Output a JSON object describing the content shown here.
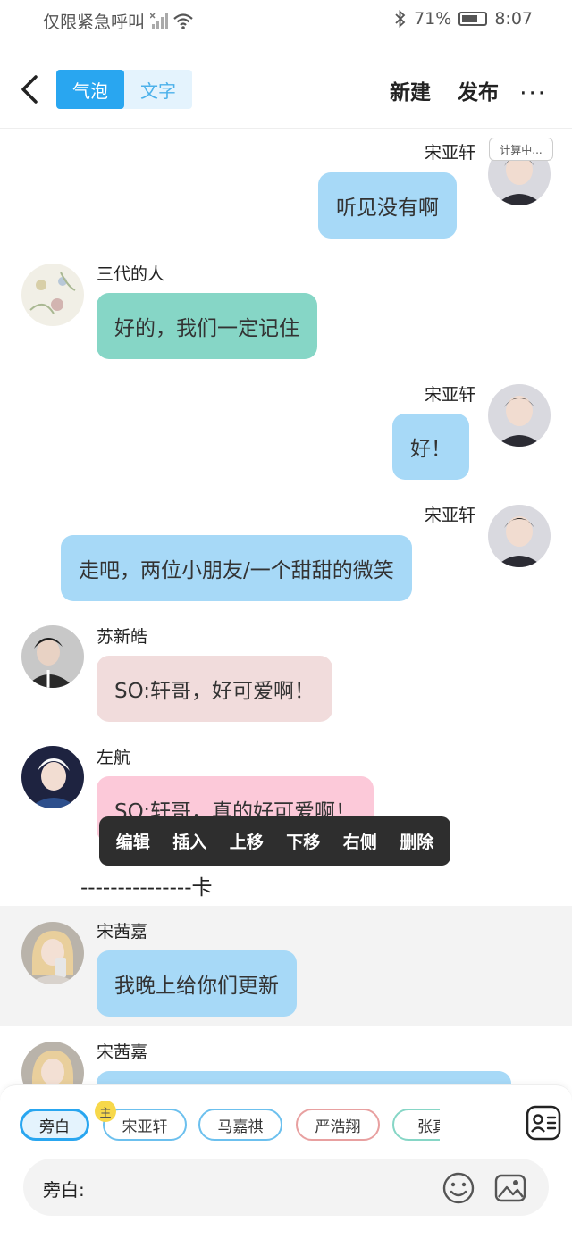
{
  "status_bar": {
    "carrier": "仅限紧急呼叫",
    "battery": "71%",
    "battery_level": 0.71,
    "time": "8:07"
  },
  "header": {
    "tabs": [
      {
        "label": "气泡",
        "active": true
      },
      {
        "label": "文字",
        "active": false
      }
    ],
    "new_label": "新建",
    "publish_label": "发布",
    "more_label": "···"
  },
  "calc_tag": "计算中...",
  "messages": [
    {
      "sender": "宋亚轩",
      "text": "听见没有啊",
      "side": "right"
    },
    {
      "sender": "三代的人",
      "text": "好的，我们一定记住",
      "side": "left"
    },
    {
      "sender": "宋亚轩",
      "text": "好！",
      "side": "right"
    },
    {
      "sender": "宋亚轩",
      "text": "走吧，两位小朋友/一个甜甜的微笑",
      "side": "right"
    },
    {
      "sender": "苏新皓",
      "text": "SO:轩哥，好可爱啊！",
      "side": "left"
    },
    {
      "sender": "左航",
      "text": "SO:轩哥，真的好可爱啊！",
      "side": "left"
    },
    {
      "sender": "宋茜嘉",
      "text": "我晚上给你们更新",
      "side": "left"
    },
    {
      "sender": "宋茜嘉",
      "text": "",
      "side": "left"
    }
  ],
  "context_menu": [
    "编辑",
    "插入",
    "上移",
    "下移",
    "右侧",
    "删除"
  ],
  "scene_divider": "---------------卡",
  "roles": [
    {
      "label": "旁白"
    },
    {
      "label": "宋亚轩"
    },
    {
      "label": "马嘉祺"
    },
    {
      "label": "严浩翔"
    },
    {
      "label": "张真"
    }
  ],
  "host_badge": "主",
  "input": {
    "label": "旁白:",
    "value": ""
  },
  "colors": {
    "accent": "#29a6f0",
    "bubble_blue": "#a7d9f7",
    "bubble_teal": "#86d6c6",
    "bubble_rose": "#f1dcdc",
    "bubble_pink": "#fcc9d9",
    "menu_bg": "#2e2e2e"
  }
}
